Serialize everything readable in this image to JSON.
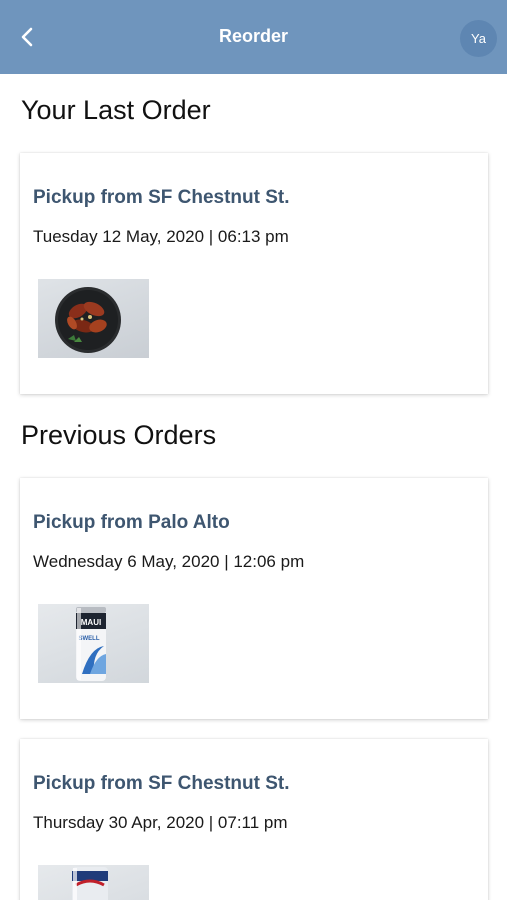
{
  "header": {
    "title": "Reorder",
    "avatar_initials": "Ya"
  },
  "last_order": {
    "section_title": "Your Last Order",
    "order": {
      "location": "Pickup from SF Chestnut St.",
      "datetime": "Tuesday 12 May, 2020 | 06:13 pm",
      "item_image": "chicken-wings-bowl"
    }
  },
  "previous_orders": {
    "section_title": "Previous Orders",
    "orders": [
      {
        "location": "Pickup from Palo Alto",
        "datetime": "Wednesday 6 May, 2020 | 12:06 pm",
        "item_image": "maui-beer-can",
        "can_brand": "MAUI",
        "can_sub": "SWELL"
      },
      {
        "location": "Pickup from SF Chestnut St.",
        "datetime": "Thursday 30 Apr, 2020 | 07:11 pm",
        "item_image": "beer-can"
      }
    ]
  },
  "colors": {
    "header_bg": "#6f95bd",
    "location_text": "#3e5670"
  }
}
